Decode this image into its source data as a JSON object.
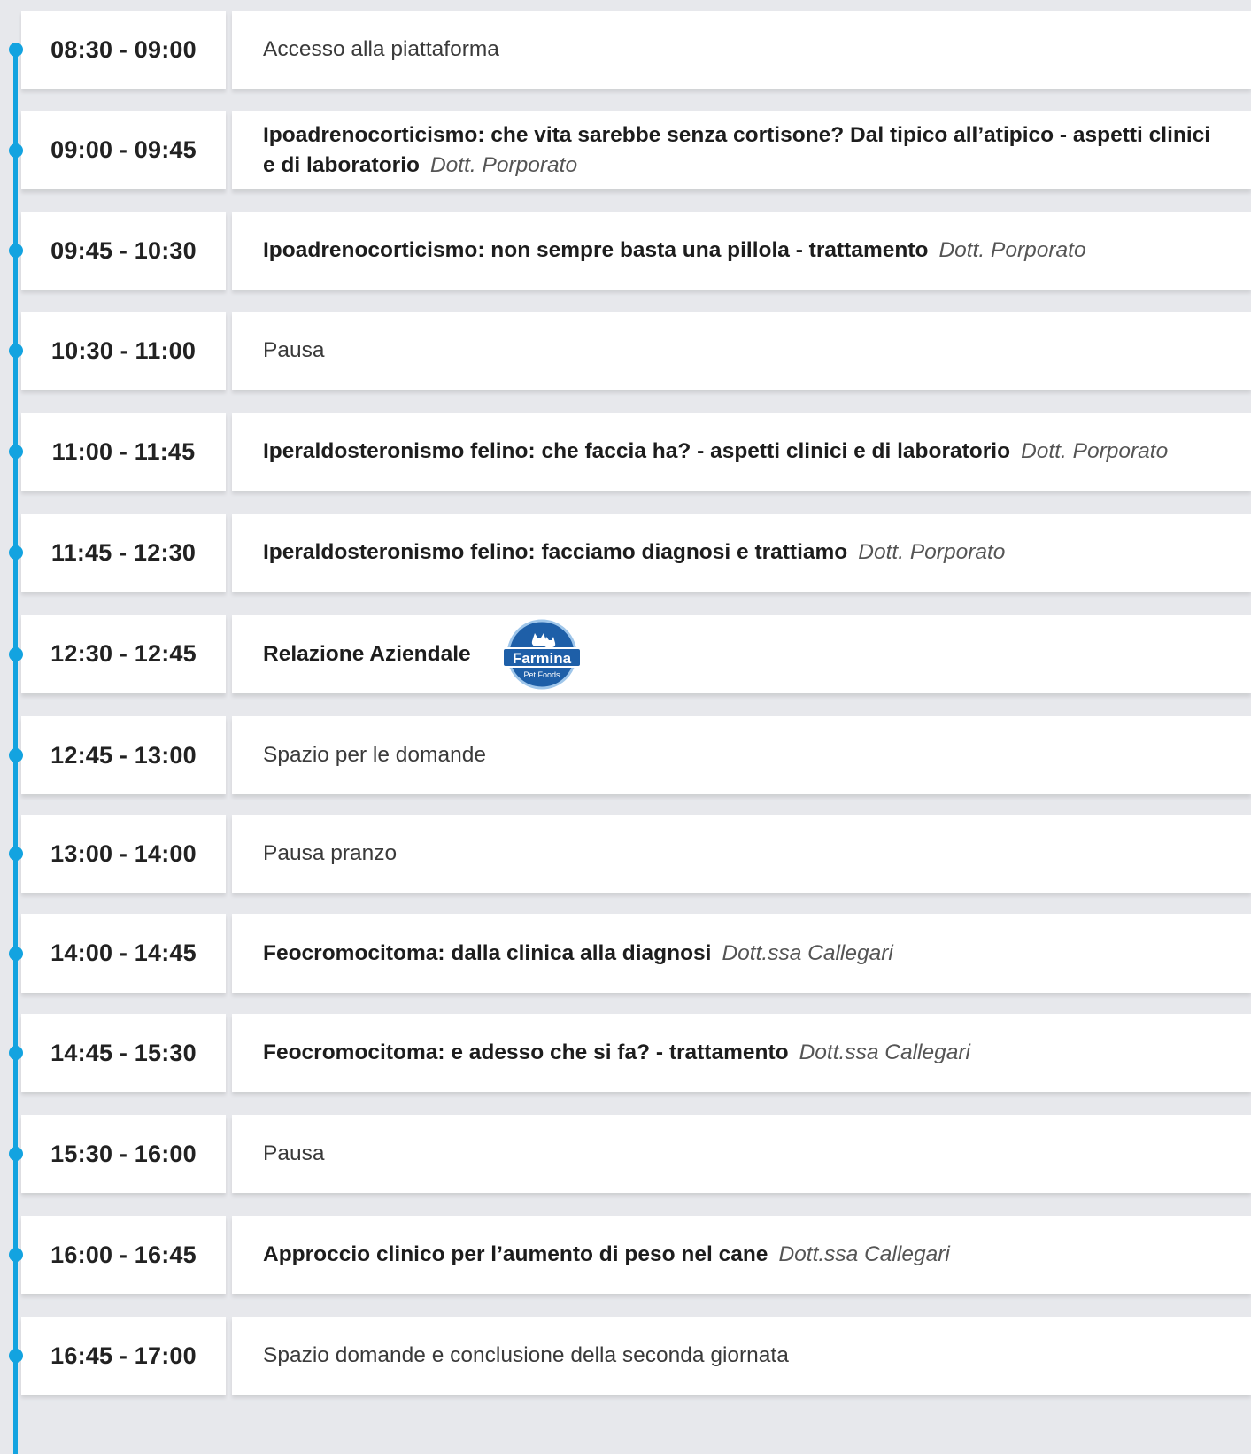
{
  "agenda": [
    {
      "time": "08:30 - 09:00",
      "type": "plain",
      "text": "Accesso alla piattaforma"
    },
    {
      "time": "09:00 - 09:45",
      "type": "talk",
      "title": "Ipoadrenocorticismo: che vita sarebbe senza cortisone? Dal tipico all’atipico - aspetti clinici e di laboratorio",
      "speaker": "Dott. Porporato"
    },
    {
      "time": "09:45 - 10:30",
      "type": "talk",
      "title": "Ipoadrenocorticismo: non sempre basta una pillola - trattamento",
      "speaker": "Dott. Porporato"
    },
    {
      "time": "10:30 - 11:00",
      "type": "plain",
      "text": "Pausa"
    },
    {
      "time": "11:00 - 11:45",
      "type": "talk",
      "title": "Iperaldosteronismo felino: che faccia ha? - aspetti clinici e di laboratorio",
      "speaker": "Dott. Porporato"
    },
    {
      "time": "11:45 - 12:30",
      "type": "talk",
      "title": "Iperaldosteronismo felino: facciamo diagnosi e trattiamo",
      "speaker": "Dott. Porporato"
    },
    {
      "time": "12:30 - 12:45",
      "type": "sponsor",
      "title": "Relazione Aziendale",
      "logo_brand": "Farmina",
      "logo_sub": "Pet Foods"
    },
    {
      "time": "12:45 - 13:00",
      "type": "plain",
      "text": "Spazio per le domande"
    },
    {
      "time": "13:00 - 14:00",
      "type": "plain",
      "text": "Pausa pranzo"
    },
    {
      "time": "14:00 - 14:45",
      "type": "talk",
      "title": "Feocromocitoma: dalla clinica alla diagnosi",
      "speaker": "Dott.ssa Callegari"
    },
    {
      "time": "14:45 - 15:30",
      "type": "talk",
      "title": "Feocromocitoma: e adesso che si fa? - trattamento",
      "speaker": "Dott.ssa Callegari"
    },
    {
      "time": "15:30 - 16:00",
      "type": "plain",
      "text": "Pausa"
    },
    {
      "time": "16:00 - 16:45",
      "type": "talk",
      "title": "Approccio clinico per l’aumento di peso nel cane",
      "speaker": "Dott.ssa Callegari"
    },
    {
      "time": "16:45 - 17:00",
      "type": "plain",
      "text": "Spazio domande e conclusione della seconda giornata"
    }
  ],
  "colors": {
    "accent": "#13a3e0",
    "background": "#e7e8ec",
    "logo_blue": "#1e5fa8"
  }
}
